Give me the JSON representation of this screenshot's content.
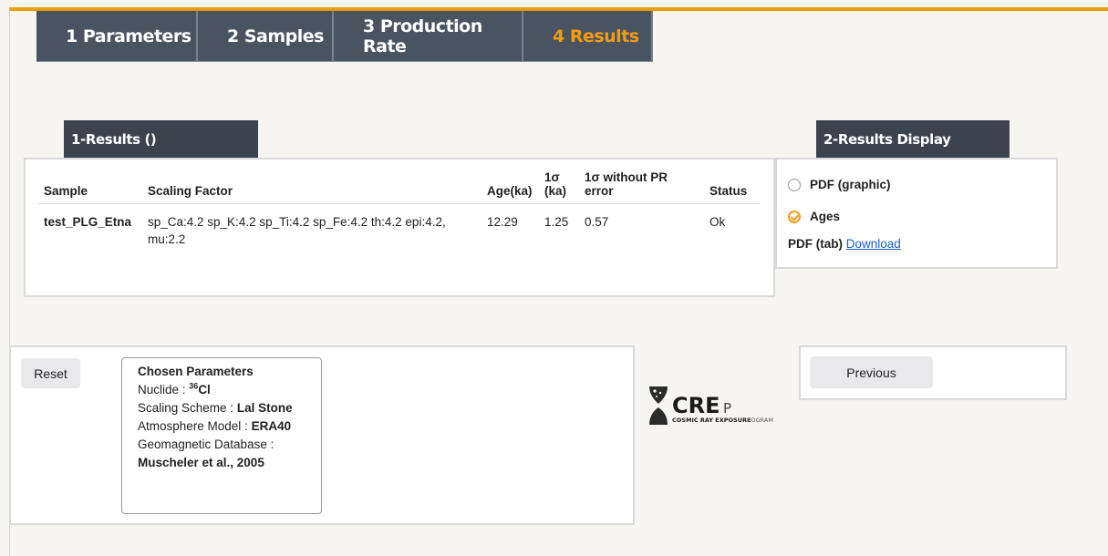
{
  "tabs": [
    {
      "label": "1 Parameters"
    },
    {
      "label": "2 Samples"
    },
    {
      "label": "3 Production Rate"
    },
    {
      "label": "4 Results"
    }
  ],
  "results": {
    "title": "1-Results ()",
    "columns": {
      "sample": "Sample",
      "scaling": "Scaling Factor",
      "age": "Age(ka)",
      "sigma_top": "1σ",
      "sigma_bottom": "(ka)",
      "without_top": "1σ without PR",
      "without_bottom": "error",
      "status": "Status"
    },
    "rows": [
      {
        "sample": "test_PLG_Etna",
        "scaling": "sp_Ca:4.2 sp_K:4.2 sp_Ti:4.2 sp_Fe:4.2 th:4.2 epi:4.2, mu:2.2",
        "age": "12.29",
        "sigma": "1.25",
        "without": "0.57",
        "status": "Ok"
      }
    ]
  },
  "display": {
    "title": "2-Results Display",
    "option_pdf": "PDF (graphic)",
    "option_ages": "Ages",
    "pdf_tab_label": "PDF (tab)",
    "download_link": "Download"
  },
  "buttons": {
    "reset": "Reset",
    "previous": "Previous"
  },
  "chosen": {
    "heading": "Chosen Parameters",
    "nuclide_label": "Nuclide :",
    "nuclide_mass": "36",
    "nuclide_symbol": "Cl",
    "scaling_label": "Scaling Scheme :",
    "scaling_value": "Lal Stone",
    "atmosphere_label": "Atmosphere Model :",
    "atmosphere_value": "ERA40",
    "geomagnetic_label": "Geomagnetic Database :",
    "geomagnetic_value": "Muscheler et al., 2005"
  },
  "logo": {
    "main": "CRE",
    "p": "P",
    "sub": "COSMIC RAY EXPOSURE",
    "program": "ROGRAM"
  },
  "colors": {
    "accent": "#f39c12",
    "tab_bg": "#4a5360",
    "title_bg": "#3b434e",
    "link": "#1d5fc1"
  }
}
